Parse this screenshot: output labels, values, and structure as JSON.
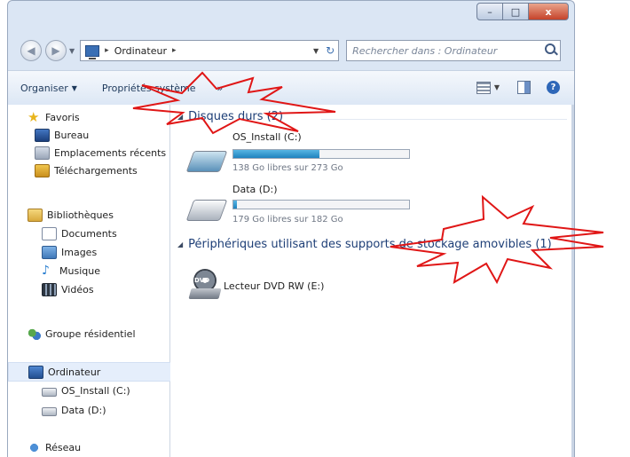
{
  "window": {
    "controls": {
      "minimize": "–",
      "maximize": "□",
      "close": "x"
    }
  },
  "address": {
    "path": [
      "Ordinateur"
    ],
    "separator": "▸",
    "search_placeholder": "Rechercher dans : Ordinateur"
  },
  "toolbar": {
    "organise": "Organiser",
    "system_props": "Propriétés système",
    "more": "»"
  },
  "nav": {
    "favorites": {
      "label": "Favoris",
      "items": [
        "Bureau",
        "Emplacements récents",
        "Téléchargements"
      ]
    },
    "libraries": {
      "label": "Bibliothèques",
      "items": [
        "Documents",
        "Images",
        "Musique",
        "Vidéos"
      ]
    },
    "homegroup": "Groupe résidentiel",
    "computer": {
      "label": "Ordinateur",
      "items": [
        "OS_Install (C:)",
        "Data (D:)"
      ]
    },
    "network": "Réseau"
  },
  "content": {
    "hard_drives": {
      "header": "Disques durs (2)",
      "drives": [
        {
          "name": "OS_Install (C:)",
          "free": "138 Go libres sur 273 Go",
          "used_fraction": 0.49
        },
        {
          "name": "Data (D:)",
          "free": "179 Go libres sur 182 Go",
          "used_fraction": 0.02
        }
      ]
    },
    "removable": {
      "header": "Périphériques utilisant des supports de stockage amovibles (1)",
      "devices": [
        {
          "name": "Lecteur DVD RW (E:)",
          "badge": "DVD"
        }
      ]
    }
  },
  "colors": {
    "annotation_red": "#e01616",
    "bar_fill": "#2a8fc8",
    "accent": "#1e3f77"
  }
}
